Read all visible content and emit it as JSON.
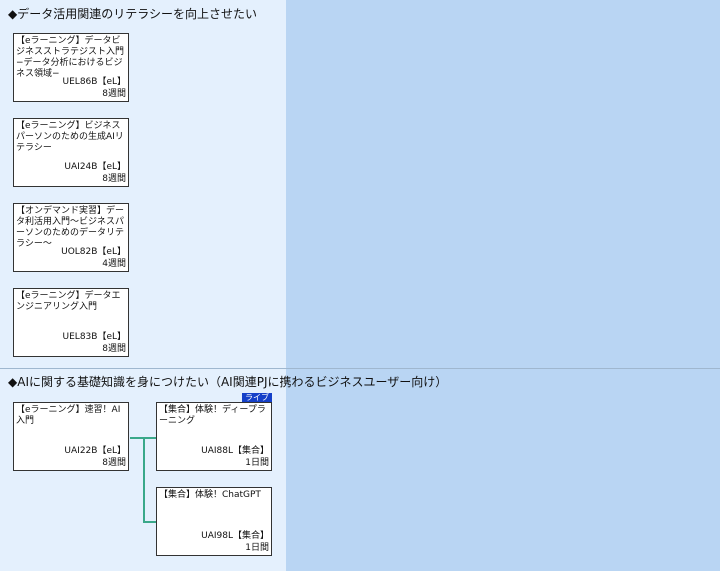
{
  "sections": [
    {
      "title": "◆データ活用関連のリテラシーを向上させたい",
      "courses": [
        {
          "title": "【eラーニング】データビジネスストラテジスト入門−データ分析におけるビジネス領域−",
          "code": "UEL86B【eL】",
          "duration": "8週間"
        },
        {
          "title": "【eラーニング】ビジネスパーソンのための生成AIリテラシー",
          "code": "UAI24B【eL】",
          "duration": "8週間"
        },
        {
          "title": "【オンデマンド実習】データ利活用入門〜ビジネスパーソンのためのデータリテラシー〜",
          "code": "UOL82B【eL】",
          "duration": "4週間"
        },
        {
          "title": "【eラーニング】データエンジニアリング入門",
          "code": "UEL83B【eL】",
          "duration": "8週間"
        }
      ]
    },
    {
      "title": "◆AIに関する基礎知識を身につけたい（AI関連PJに携わるビジネスユーザー向け）",
      "courses": [
        {
          "title": "【eラーニング】速習！AI入門",
          "code": "UAI22B【eL】",
          "duration": "8週間"
        },
        {
          "title": "【集合】体験！ディープラーニング",
          "code": "UAI88L【集合】",
          "duration": "1日間",
          "badge": "ライブ"
        },
        {
          "title": "【集合】体験！ChatGPT",
          "code": "UAI98L【集合】",
          "duration": "1日間"
        }
      ]
    }
  ]
}
